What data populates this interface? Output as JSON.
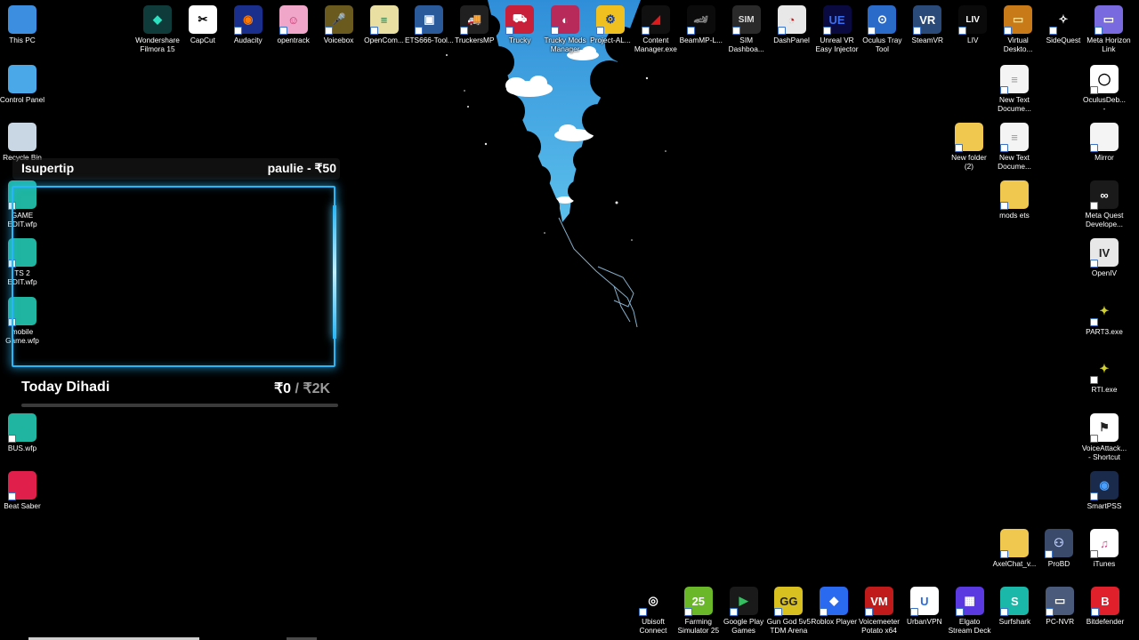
{
  "desktop": {
    "left_icons": [
      {
        "label": "This PC",
        "icon": "this-pc-icon",
        "color": "#3c8ee0"
      },
      {
        "label": "Control Panel",
        "icon": "control-panel-icon",
        "color": "#4aa8e8"
      },
      {
        "label": "Recycle Bin",
        "icon": "recycle-bin-icon",
        "color": "#c9d6e3"
      },
      {
        "label": "GAME\nEDIT.wfp",
        "icon": "filmora-project-icon",
        "color": "#1fb5a0"
      },
      {
        "label": "TS 2\nEDIT.wfp",
        "icon": "filmora-project-icon",
        "color": "#1fb5a0"
      },
      {
        "label": "mobile\nGame.wfp",
        "icon": "filmora-project-icon",
        "color": "#1fb5a0"
      },
      {
        "label": "BUS.wfp",
        "icon": "filmora-project-icon",
        "color": "#1fb5a0"
      },
      {
        "label": "Beat Saber",
        "icon": "beat-saber-icon",
        "color": "#e0204a"
      }
    ],
    "top_icons": [
      {
        "label": "Wondershare\nFilmora 15",
        "icon": "filmora-icon",
        "glyph": "◆",
        "bg": "#0f3b3a",
        "fg": "#2de0c0"
      },
      {
        "label": "CapCut",
        "icon": "capcut-icon",
        "glyph": "✂",
        "bg": "#ffffff",
        "fg": "#000000"
      },
      {
        "label": "Audacity",
        "icon": "audacity-icon",
        "glyph": "◉",
        "bg": "#1a2f8c",
        "fg": "#ff7a00"
      },
      {
        "label": "opentrack",
        "icon": "opentrack-icon",
        "glyph": "☺",
        "bg": "#f0a6c8",
        "fg": "#c0306a"
      },
      {
        "label": "Voicebox",
        "icon": "voicebox-icon",
        "glyph": "🎤",
        "bg": "#6b5a1e",
        "fg": "#e8d080"
      },
      {
        "label": "OpenCom...",
        "icon": "opencomposite-icon",
        "glyph": "≡",
        "bg": "#e9dfa2",
        "fg": "#2a6e3a"
      },
      {
        "label": "ETS666-Tool...",
        "icon": "ets666-tool-icon",
        "glyph": "▣",
        "bg": "#2b5a9a",
        "fg": "#ffffff"
      },
      {
        "label": "TruckersMP",
        "icon": "truckersmp-icon",
        "glyph": "🚚",
        "bg": "#202020",
        "fg": "#ffffff"
      },
      {
        "label": "Trucky",
        "icon": "trucky-icon",
        "glyph": "⛟",
        "bg": "#c8203a",
        "fg": "#ffffff"
      },
      {
        "label": "Trucky Mods\nManager",
        "icon": "trucky-mods-manager-icon",
        "glyph": "◐",
        "bg": "#b82a5a",
        "fg": "#ffffff"
      },
      {
        "label": "Project-AL...",
        "icon": "project-al-icon",
        "glyph": "⚙",
        "bg": "#f0c020",
        "fg": "#1a3a8a"
      },
      {
        "label": "Content\nManager.exe",
        "icon": "content-manager-icon",
        "glyph": "◢",
        "bg": "#101010",
        "fg": "#e01a1a"
      },
      {
        "label": "BeamMP-L...",
        "icon": "beammp-launcher-icon",
        "glyph": "🏎",
        "bg": "#0b0b0b",
        "fg": "#888888"
      },
      {
        "label": "SIM\nDashboa...",
        "icon": "sim-dashboard-icon",
        "glyph": "SIM",
        "bg": "#2a2a2a",
        "fg": "#dddddd"
      },
      {
        "label": "DashPanel",
        "icon": "dashpanel-icon",
        "glyph": "◔",
        "bg": "#e8e8e8",
        "fg": "#c02020"
      },
      {
        "label": "Unreal VR\nEasy Injector",
        "icon": "unreal-vr-injector-icon",
        "glyph": "UE",
        "bg": "#0a0a40",
        "fg": "#3a6ef0"
      },
      {
        "label": "Oculus Tray\nTool",
        "icon": "oculus-tray-tool-icon",
        "glyph": "⊙",
        "bg": "#2a6ac8",
        "fg": "#ffffff"
      },
      {
        "label": "SteamVR",
        "icon": "steamvr-icon",
        "glyph": "VR",
        "bg": "#2a4a7a",
        "fg": "#ffffff"
      },
      {
        "label": "LIV",
        "icon": "liv-icon",
        "glyph": "LIV",
        "bg": "#0a0a0a",
        "fg": "#ffffff"
      },
      {
        "label": "Virtual\nDeskto...",
        "icon": "virtual-desktop-icon",
        "glyph": "▭",
        "bg": "#c87a18",
        "fg": "#ffdd88"
      },
      {
        "label": "SideQuest",
        "icon": "sidequest-icon",
        "glyph": "✧",
        "bg": "#000000",
        "fg": "#ffffff"
      },
      {
        "label": "Meta Horizon\nLink",
        "icon": "meta-horizon-link-icon",
        "glyph": "▭",
        "bg": "#7a6adf",
        "fg": "#ffffff"
      }
    ],
    "right_icons": [
      {
        "label": "New Text\nDocume...",
        "icon": "text-document-icon",
        "glyph": "≡",
        "bg": "#f4f4f4",
        "fg": "#9a9a9a"
      },
      {
        "label": "OculusDeb...\n-",
        "icon": "oculus-debug-tool-icon",
        "glyph": "◯",
        "bg": "#ffffff",
        "fg": "#000000"
      },
      {
        "label": "New folder\n(2)",
        "icon": "folder-icon",
        "glyph": "",
        "bg": "#f0c850",
        "fg": "#d8a830"
      },
      {
        "label": "New Text\nDocume...",
        "icon": "text-document-icon",
        "glyph": "≡",
        "bg": "#f4f4f4",
        "fg": "#9a9a9a"
      },
      {
        "label": "Mirror",
        "icon": "mirror-file-icon",
        "glyph": "",
        "bg": "#f4f4f4",
        "fg": "#9a9a9a"
      },
      {
        "label": "mods ets",
        "icon": "folder-icon",
        "glyph": "",
        "bg": "#f0c850",
        "fg": "#d8a830"
      },
      {
        "label": "Meta Quest\nDevelope...",
        "icon": "meta-quest-developer-icon",
        "glyph": "∞",
        "bg": "#1a1a1a",
        "fg": "#ffffff"
      },
      {
        "label": "OpenIV",
        "icon": "openiv-icon",
        "glyph": "IV",
        "bg": "#e8e8e8",
        "fg": "#222222"
      },
      {
        "label": "PART3.exe",
        "icon": "part3-exe-icon",
        "glyph": "✦",
        "bg": "#000000",
        "fg": "#d0d030"
      },
      {
        "label": "RTI.exe",
        "icon": "rti-exe-icon",
        "glyph": "✦",
        "bg": "#000000",
        "fg": "#d0d030"
      },
      {
        "label": "VoiceAttack...\n- Shortcut",
        "icon": "voiceattack-icon",
        "glyph": "⚑",
        "bg": "#ffffff",
        "fg": "#222222"
      },
      {
        "label": "SmartPSS",
        "icon": "smartpss-icon",
        "glyph": "◉",
        "bg": "#1a2a4a",
        "fg": "#4aa0ff"
      },
      {
        "label": "AxelChat_v...",
        "icon": "folder-icon",
        "glyph": "",
        "bg": "#f0c850",
        "fg": "#d8a830"
      },
      {
        "label": "ProBD",
        "icon": "probd-icon",
        "glyph": "⚇",
        "bg": "#3a4a6a",
        "fg": "#c0d0ff"
      },
      {
        "label": "iTunes",
        "icon": "itunes-icon",
        "glyph": "♫",
        "bg": "#ffffff",
        "fg": "#e0408a"
      }
    ],
    "bottom_icons": [
      {
        "label": "Ubisoft\nConnect",
        "icon": "ubisoft-connect-icon",
        "glyph": "◎",
        "bg": "#000000",
        "fg": "#ffffff"
      },
      {
        "label": "Farming\nSimulator 25",
        "icon": "farming-simulator-icon",
        "glyph": "25",
        "bg": "#6ab82a",
        "fg": "#ffffff"
      },
      {
        "label": "Google Play\nGames",
        "icon": "google-play-games-icon",
        "glyph": "▶",
        "bg": "#1a1a1a",
        "fg": "#34c060"
      },
      {
        "label": "Gun God 5v5\nTDM Arena",
        "icon": "gun-god-icon",
        "glyph": "GG",
        "bg": "#d8c020",
        "fg": "#202020"
      },
      {
        "label": "Roblox Player",
        "icon": "roblox-icon",
        "glyph": "◆",
        "bg": "#2a6af0",
        "fg": "#ffffff"
      },
      {
        "label": "Voicemeeter\nPotato x64",
        "icon": "voicemeeter-icon",
        "glyph": "VM",
        "bg": "#c01a1a",
        "fg": "#ffffff"
      },
      {
        "label": "UrbanVPN",
        "icon": "urbanvpn-icon",
        "glyph": "U",
        "bg": "#ffffff",
        "fg": "#2a6ae0"
      },
      {
        "label": "Elgato\nStream Deck",
        "icon": "elgato-stream-deck-icon",
        "glyph": "▦",
        "bg": "#5a3ae0",
        "fg": "#ffffff"
      },
      {
        "label": "Surfshark",
        "icon": "surfshark-icon",
        "glyph": "S",
        "bg": "#1ab8a8",
        "fg": "#ffffff"
      },
      {
        "label": "PC-NVR",
        "icon": "pc-nvr-icon",
        "glyph": "▭",
        "bg": "#4a5a7a",
        "fg": "#ffffff"
      },
      {
        "label": "Bitdefender",
        "icon": "bitdefender-icon",
        "glyph": "B",
        "bg": "#e0202a",
        "fg": "#ffffff"
      }
    ]
  },
  "overlay": {
    "tip_user": "Isupertip",
    "tip_amount": "paulie - ₹50",
    "goal_title": "Today Dihadi",
    "goal_current": "₹0",
    "goal_separator": "/",
    "goal_target": "₹2K",
    "goal_progress": 0,
    "accent_color": "#29b6f6"
  }
}
